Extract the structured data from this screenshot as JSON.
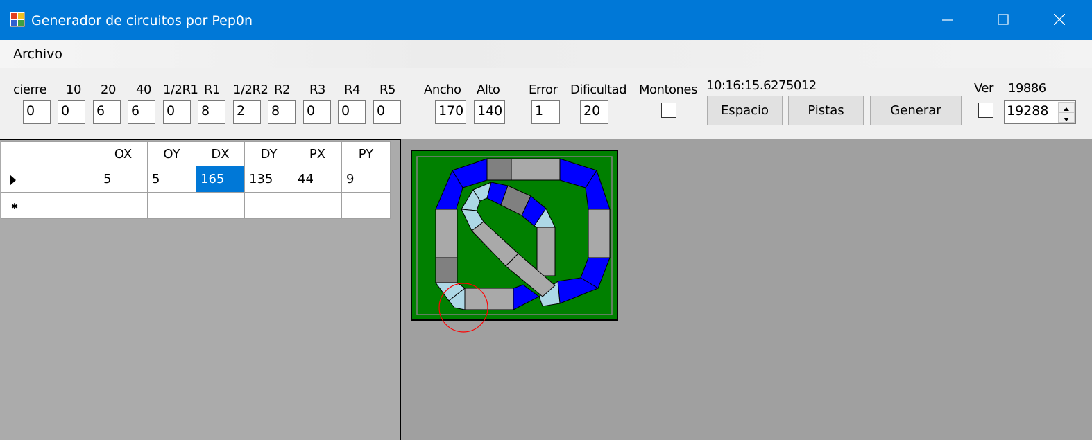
{
  "window": {
    "title": "Generador de circuitos por Pep0n"
  },
  "menu": {
    "items": [
      "Archivo"
    ]
  },
  "toolbar": {
    "fields": [
      {
        "label": "cierre",
        "value": "0"
      },
      {
        "label": "10",
        "value": "0"
      },
      {
        "label": "20",
        "value": "6"
      },
      {
        "label": "40",
        "value": "6"
      },
      {
        "label": "1/2R1",
        "value": "0"
      },
      {
        "label": "R1",
        "value": "8"
      },
      {
        "label": "1/2R2",
        "value": "2"
      },
      {
        "label": "R2",
        "value": "8"
      },
      {
        "label": "R3",
        "value": "0"
      },
      {
        "label": "R4",
        "value": "0"
      },
      {
        "label": "R5",
        "value": "0"
      }
    ],
    "ancho": {
      "label": "Ancho",
      "value": "170"
    },
    "alto": {
      "label": "Alto",
      "value": "140"
    },
    "error": {
      "label": "Error",
      "value": "1"
    },
    "dificultad": {
      "label": "Dificultad",
      "value": "20"
    },
    "montones": {
      "label": "Montones",
      "checked": false
    },
    "timestamp": "10:16:15.6275012",
    "buttons": {
      "espacio": "Espacio",
      "pistas": "Pistas",
      "generar": "Generar"
    },
    "ver": {
      "label": "Ver",
      "checked": false
    },
    "seed_label": "19886",
    "seed_value": "19288"
  },
  "grid": {
    "columns": [
      "OX",
      "OY",
      "DX",
      "DY",
      "PX",
      "PY"
    ],
    "rows": [
      [
        "5",
        "5",
        "165",
        "135",
        "44",
        "9"
      ]
    ],
    "selected_cell": "DX"
  },
  "colors": {
    "titlebar": "#0078d7",
    "board_green": "#008000",
    "track_blue": "#0000ff",
    "track_light": "#add8e6",
    "track_gray": "#a9a9a9",
    "track_dark": "#808080",
    "marker_red": "#ff0000"
  }
}
